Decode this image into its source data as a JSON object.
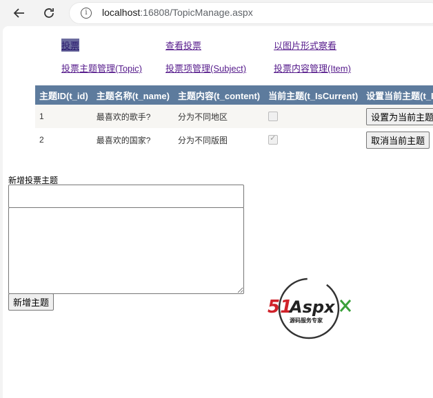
{
  "browser": {
    "url_host": "localhost",
    "url_rest": ":16808/TopicManage.aspx"
  },
  "menu": {
    "row1": [
      "投票",
      "查看投票",
      "以图片形式察看"
    ],
    "row2": [
      "投票主题管理(Topic)",
      "投票项管理(Subject)",
      "投票内容管理(Item)"
    ]
  },
  "grid": {
    "headers": [
      "主题ID(t_id)",
      "主题名称(t_name)",
      "主题内容(t_content)",
      "当前主题(t_IsCurrent)",
      "设置当前主题(t_I"
    ],
    "rows": [
      {
        "id": "1",
        "name": "最喜欢的歌手?",
        "content": "分为不同地区",
        "current": false,
        "action": "设置为当前主题"
      },
      {
        "id": "2",
        "name": "最喜欢的国家?",
        "content": "分为不同版图",
        "current": true,
        "action": "取消当前主题"
      }
    ]
  },
  "form": {
    "label": "新增投票主题",
    "name_value": "",
    "content_value": "",
    "submit": "新增主题"
  },
  "logo": {
    "brand": "51Aspx",
    "tagline": "源码服务专家"
  },
  "colors": {
    "grid_header": "#5d7b9d",
    "link": "#551a8b",
    "logo_red": "#d0222a",
    "logo_green": "#3aa03a"
  }
}
